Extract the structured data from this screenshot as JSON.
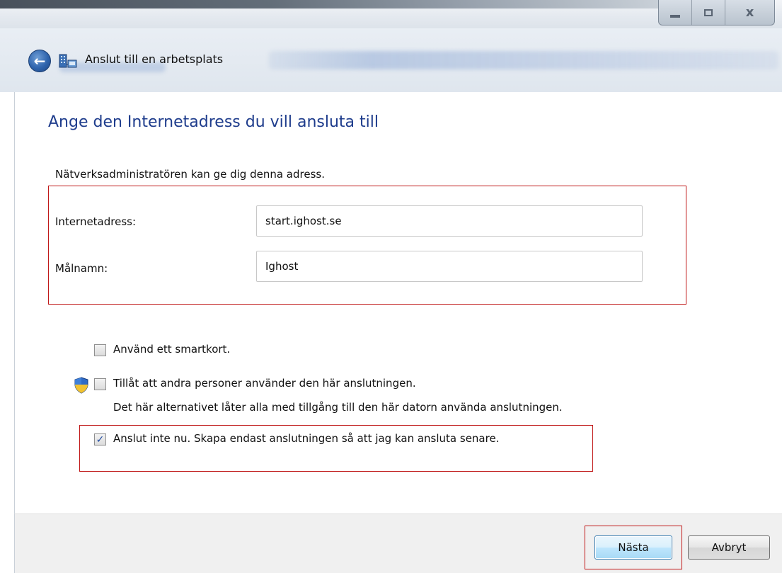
{
  "window": {
    "header_title": "Anslut till en arbetsplats",
    "controls": {
      "minimize": "",
      "maximize": "",
      "close": "x"
    }
  },
  "icons": {
    "back": "back-arrow-icon",
    "network": "network-icon",
    "shield": "uac-shield-icon"
  },
  "main": {
    "heading": "Ange den Internetadress du vill ansluta till",
    "hint": "Nätverksadministratören kan ge dig denna adress.",
    "fields": [
      {
        "label": "Internetadress:",
        "value": "start.ighost.se"
      },
      {
        "label": "Målnamn:",
        "value": "Ighost"
      }
    ],
    "options": [
      {
        "label": "Använd ett smartkort.",
        "checked": false
      },
      {
        "label": "Tillåt att andra personer använder den här anslutningen.",
        "checked": false,
        "description": "Det här alternativet låter alla med tillgång till den här datorn använda anslutningen."
      },
      {
        "label": "Anslut inte nu. Skapa endast anslutningen så att jag kan ansluta senare.",
        "checked": true
      }
    ]
  },
  "footer": {
    "next_label": "Nästa",
    "cancel_label": "Avbryt"
  },
  "colors": {
    "heading": "#1e3c8c",
    "highlight_box": "#c01818"
  }
}
